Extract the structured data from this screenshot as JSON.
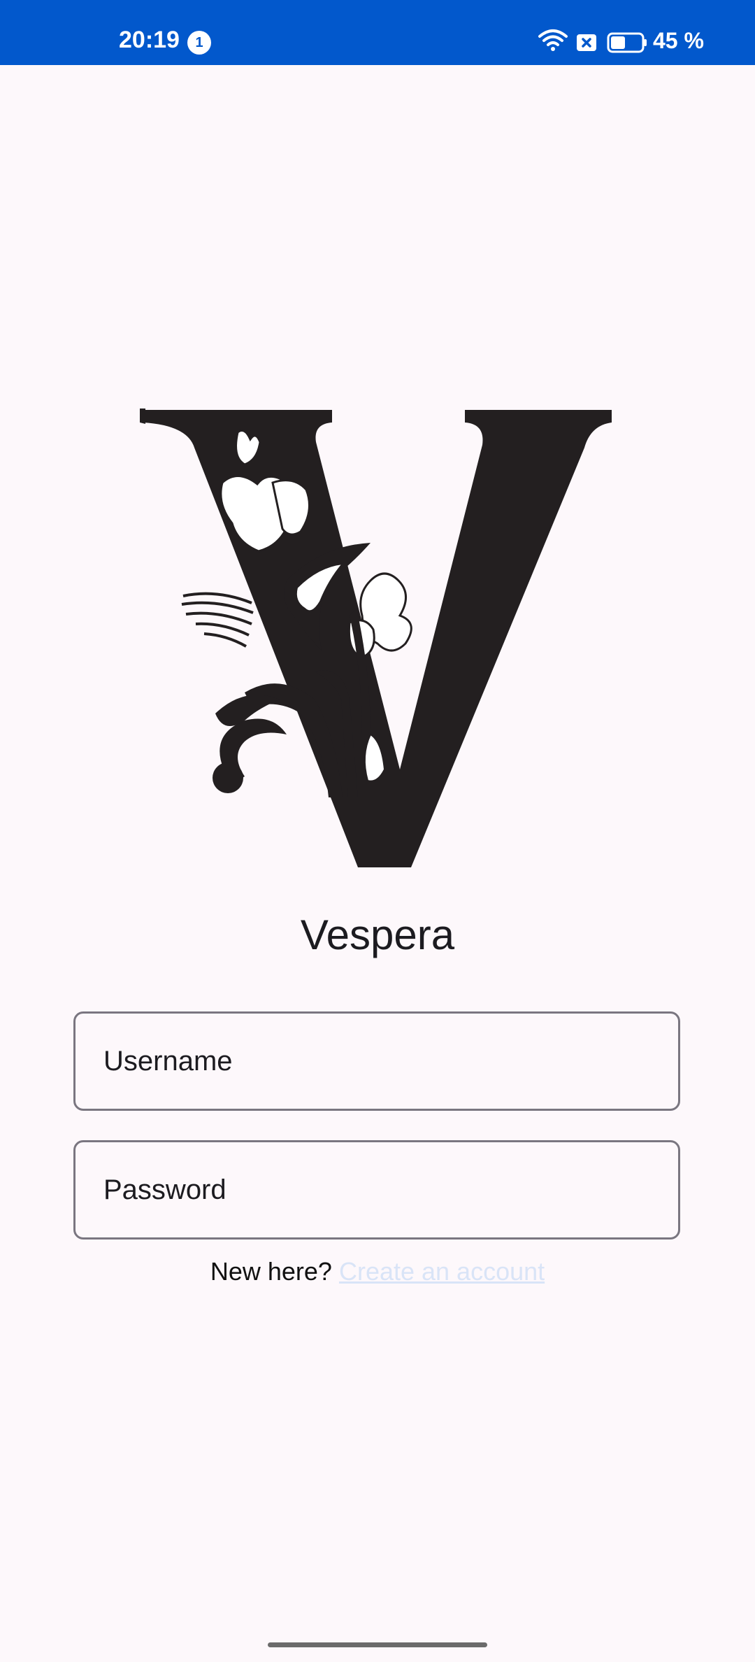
{
  "status_bar": {
    "time": "20:19",
    "notification_count": "1",
    "battery_percent": "45 %",
    "background_color": "#0258cc"
  },
  "app": {
    "name": "Vespera",
    "logo_icon": "vespera-floral-v-logo"
  },
  "login_form": {
    "username_placeholder": "Username",
    "username_value": "",
    "password_placeholder": "Password",
    "password_value": ""
  },
  "signup": {
    "prompt": "New here?",
    "link_label": "Create an account",
    "link_color": "#d9e4f7"
  }
}
